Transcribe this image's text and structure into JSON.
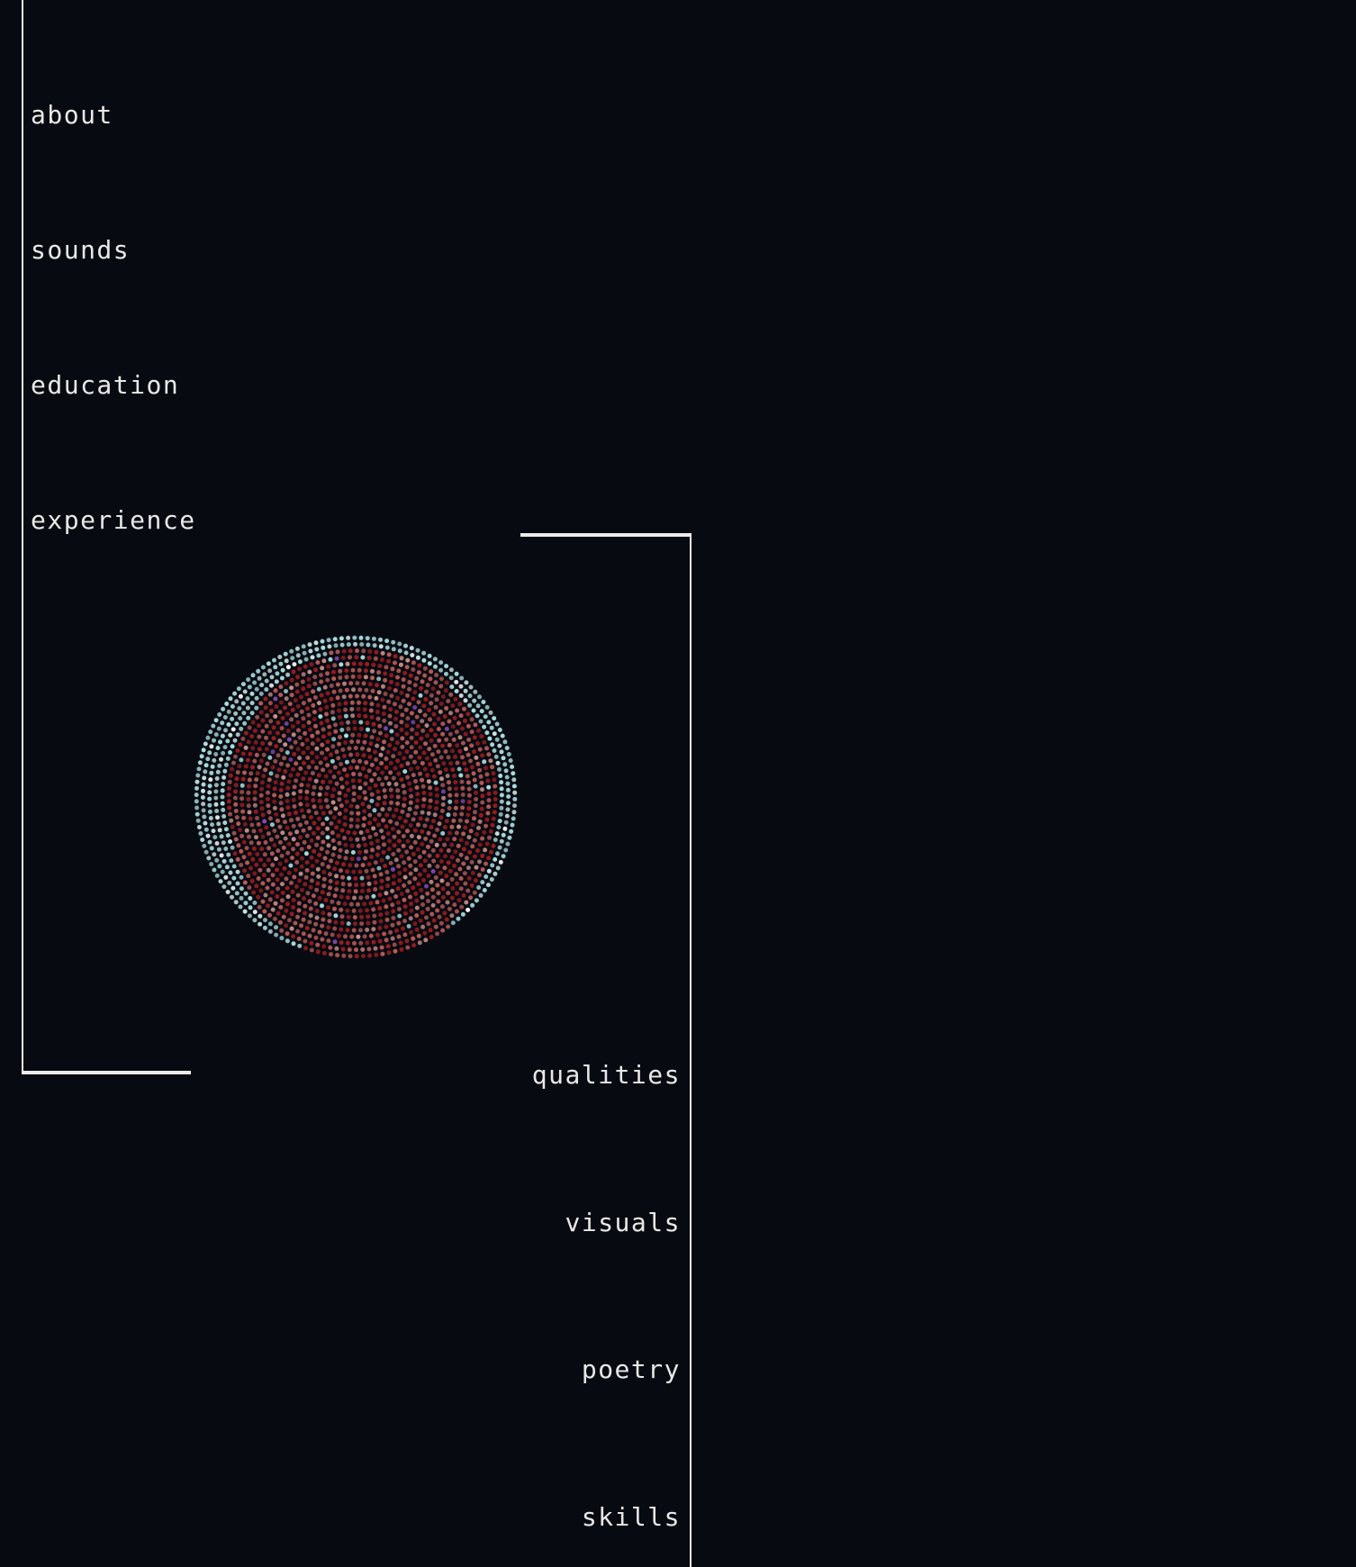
{
  "nav_left": [
    {
      "label": "about"
    },
    {
      "label": "sounds"
    },
    {
      "label": "education"
    },
    {
      "label": "experience"
    }
  ],
  "nav_right": [
    {
      "label": "qualities"
    },
    {
      "label": "visuals"
    },
    {
      "label": "poetry"
    },
    {
      "label": "skills"
    }
  ],
  "art": {
    "icon": "pointillist-portrait-orb",
    "colors": {
      "outer_ring": "#a9dede",
      "inner_warm": "#b85b55",
      "inner_deep": "#9a1e1e",
      "accent_purple": "#8a4bb0"
    }
  },
  "theme": {
    "background": "#080a12",
    "text": "#e8e8e8",
    "frame": "#ececec"
  }
}
